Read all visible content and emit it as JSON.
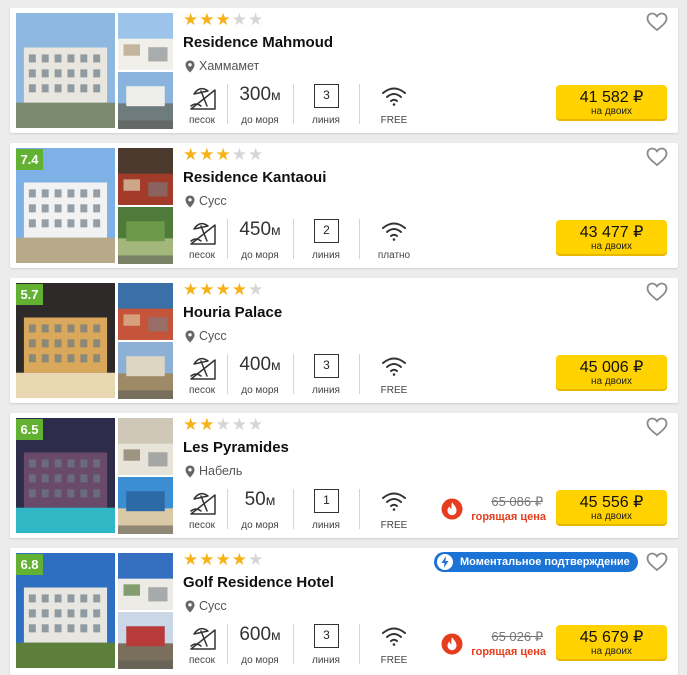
{
  "colors": {
    "accent_yellow": "#ffd200",
    "star": "#f7b219",
    "rating_green": "#63b132",
    "hot_red": "#e53d1e",
    "instant_blue": "#1b73d6"
  },
  "labels": {
    "beach": "песок",
    "to_sea": "до моря",
    "line": "линия",
    "for_two": "на двоих",
    "hot_price": "горящая цена",
    "distance_unit": "м"
  },
  "hotels": [
    {
      "name": "Residence Mahmoud",
      "stars": 3,
      "rating": "",
      "location": "Хаммамет",
      "distance": "300",
      "line": "3",
      "wifi": "FREE",
      "price": "41 582 ₽",
      "old_price": "",
      "instant": ""
    },
    {
      "name": "Residence Kantaoui",
      "stars": 3,
      "rating": "7.4",
      "location": "Сусс",
      "distance": "450",
      "line": "2",
      "wifi": "платно",
      "price": "43 477 ₽",
      "old_price": "",
      "instant": ""
    },
    {
      "name": "Houria Palace",
      "stars": 4,
      "rating": "5.7",
      "location": "Сусс",
      "distance": "400",
      "line": "3",
      "wifi": "FREE",
      "price": "45 006 ₽",
      "old_price": "",
      "instant": ""
    },
    {
      "name": "Les Pyramides",
      "stars": 2,
      "rating": "6.5",
      "location": "Набель",
      "distance": "50",
      "line": "1",
      "wifi": "FREE",
      "price": "45 556 ₽",
      "old_price": "65 086 ₽",
      "instant": ""
    },
    {
      "name": "Golf Residence Hotel",
      "stars": 4,
      "rating": "6.8",
      "location": "Сусс",
      "distance": "600",
      "line": "3",
      "wifi": "FREE",
      "price": "45 679 ₽",
      "old_price": "65 026 ₽",
      "instant": "Моментальное подтверждение"
    }
  ]
}
